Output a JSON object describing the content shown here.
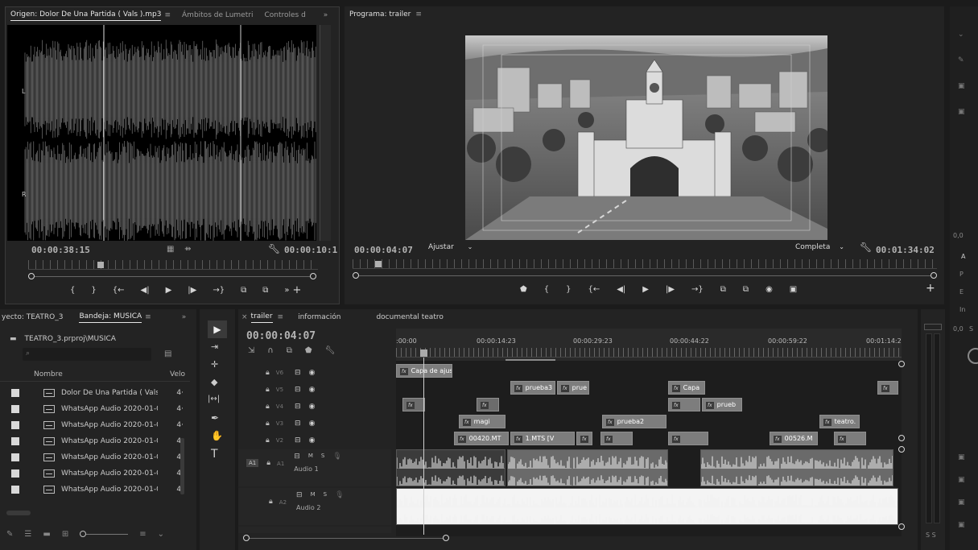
{
  "source_monitor": {
    "tabs": [
      "Origen: Dolor De Una Partida ( Vals ).mp3",
      "Ámbitos de Lumetri",
      "Controles d"
    ],
    "menu_glyph": "≡",
    "overflow": "»",
    "channel_left": "L",
    "channel_right": "R",
    "timecode_in": "00:00:38:15",
    "timecode_dur": "00:00:10:1",
    "transport": [
      "{",
      "}",
      "{←",
      "◀|",
      "▶",
      "|▶",
      "→}",
      "⧉",
      "⧉",
      "»",
      "+"
    ]
  },
  "program_monitor": {
    "title": "Programa: trailer",
    "menu_glyph": "≡",
    "timecode": "00:00:04:07",
    "fit_label": "Ajustar",
    "quality_label": "Completa",
    "duration": "00:01:34:02",
    "transport": [
      "⬟",
      "{",
      "}",
      "{←",
      "◀|",
      "▶",
      "|▶",
      "→}",
      "⧉",
      "⧉",
      "◉",
      "▣"
    ],
    "add": "+"
  },
  "project_panel": {
    "tabs": [
      "yecto: TEATRO_3",
      "Bandeja: MUSICA"
    ],
    "menu_glyph": "≡",
    "overflow": "»",
    "path": "TEATRO_3.prproj\\MUSICA",
    "col_name": "Nombre",
    "col_velo": "Velo",
    "items": [
      {
        "name": "Dolor De Una Partida ( Vals",
        "velo": "4·"
      },
      {
        "name": "WhatsApp Audio 2020-01-0",
        "velo": "4·"
      },
      {
        "name": "WhatsApp Audio 2020-01-0",
        "velo": "4·"
      },
      {
        "name": "WhatsApp Audio 2020-01-0",
        "velo": "4·"
      },
      {
        "name": "WhatsApp Audio 2020-01-0",
        "velo": "4·"
      },
      {
        "name": "WhatsApp Audio 2020-01-0",
        "velo": "4·"
      },
      {
        "name": "WhatsApp Audio 2020-01-0",
        "velo": "4·"
      }
    ]
  },
  "tools": [
    "▶",
    "⇥",
    "✛",
    "◆",
    "|↔|",
    "✒",
    "✋",
    "T"
  ],
  "timeline": {
    "tabs": [
      "trailer",
      "información",
      "documental teatro"
    ],
    "close": "×",
    "menu_glyph": "≡",
    "timecode": "00:00:04:07",
    "ruler_labels": [
      ":00:00",
      "00:00:14:23",
      "00:00:29:23",
      "00:00:44:22",
      "00:00:59:22",
      "00:01:14:2"
    ],
    "video_tracks": [
      "V6",
      "V5",
      "V4",
      "V3",
      "V2"
    ],
    "audio_tracks": [
      {
        "id": "A1",
        "src": "A1",
        "name": "Audio 1",
        "m": "M",
        "s": "S"
      },
      {
        "id": "A2",
        "src": "",
        "name": "Audio 2",
        "m": "M",
        "s": "S"
      }
    ],
    "clips": {
      "v6": [
        "Capa de ajust"
      ],
      "v5": [
        "prueba3",
        "prue",
        "Capa"
      ],
      "v4": [
        "prueb"
      ],
      "v3": [
        "magi",
        "prueba2",
        "teatro."
      ],
      "v2": [
        "00420.MT",
        "1.MTS [V",
        "00526.M"
      ]
    }
  },
  "right_panel": {
    "labels": [
      "0,0",
      "A",
      "P",
      "E",
      "In",
      "0,0",
      "S"
    ],
    "meter_bottom": "S S"
  }
}
